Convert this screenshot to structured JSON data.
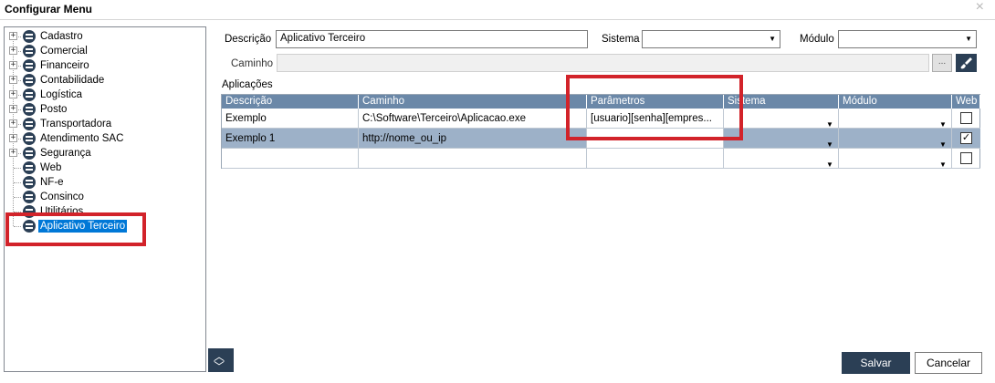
{
  "window": {
    "title": "Configurar Menu",
    "close_icon": "×"
  },
  "tree": {
    "items": [
      {
        "label": "Cadastro",
        "expandable": true
      },
      {
        "label": "Comercial",
        "expandable": true
      },
      {
        "label": "Financeiro",
        "expandable": true
      },
      {
        "label": "Contabilidade",
        "expandable": true
      },
      {
        "label": "Logística",
        "expandable": true
      },
      {
        "label": "Posto",
        "expandable": true
      },
      {
        "label": "Transportadora",
        "expandable": true
      },
      {
        "label": "Atendimento SAC",
        "expandable": true
      },
      {
        "label": "Segurança",
        "expandable": true
      },
      {
        "label": "Web",
        "expandable": false
      },
      {
        "label": "NF-e",
        "expandable": false
      },
      {
        "label": "Consinco",
        "expandable": false
      },
      {
        "label": "Utilitários",
        "expandable": false
      },
      {
        "label": "Aplicativo Terceiro",
        "expandable": false,
        "selected": true
      }
    ],
    "expand_glyph": "+"
  },
  "form": {
    "descricao_label": "Descrição",
    "descricao_value": "Aplicativo Terceiro",
    "sistema_label": "Sistema",
    "sistema_value": "",
    "modulo_label": "Módulo",
    "modulo_value": "",
    "caminho_label": "Caminho",
    "caminho_value": "",
    "dots_label": "...",
    "dropdown_arrow": "▼"
  },
  "grid": {
    "section_label": "Aplicações",
    "columns": [
      "Descrição",
      "Caminho",
      "Parâmetros",
      "Sistema",
      "Módulo",
      "Web"
    ],
    "rows": [
      {
        "descricao": "Exemplo",
        "caminho": "C:\\Software\\Terceiro\\Aplicacao.exe",
        "parametros": "[usuario][senha][empres...",
        "sistema": "",
        "modulo": "",
        "web": false
      },
      {
        "descricao": "Exemplo 1",
        "caminho": "http://nome_ou_ip",
        "parametros": "",
        "sistema": "",
        "modulo": "",
        "web": true
      },
      {
        "descricao": "",
        "caminho": "",
        "parametros": "",
        "sistema": "",
        "modulo": "",
        "web": false
      }
    ],
    "check_glyph": "✓"
  },
  "buttons": {
    "save": "Salvar",
    "cancel": "Cancelar",
    "nav_up": "︿",
    "nav_down": "﹀"
  },
  "colors": {
    "accent": "#2b3f55",
    "header": "#6b88a8",
    "selected_row": "#9db1c8",
    "highlight": "#d2232a",
    "tree_selected": "#0078d7"
  }
}
